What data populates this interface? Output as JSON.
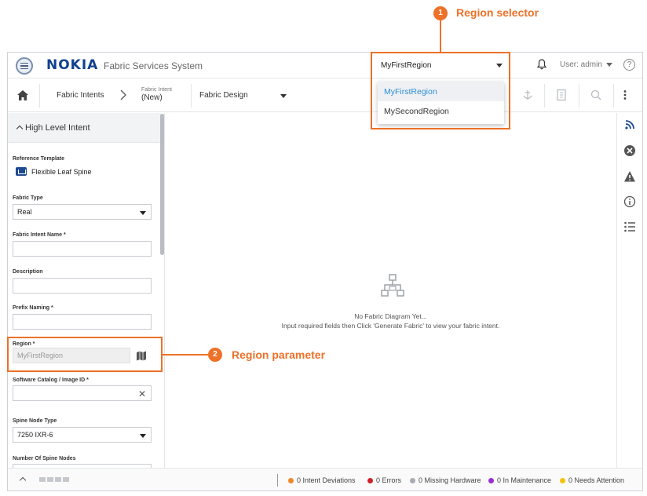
{
  "header": {
    "logo": "NOKIA",
    "app_title": "Fabric Services System",
    "region_selected": "MyFirstRegion",
    "user_label": "User: admin",
    "help": "?"
  },
  "toolbar": {
    "breadcrumb_intents": "Fabric Intents",
    "breadcrumb_intent_small": "Fabric Intent",
    "breadcrumb_intent_big": "(New)",
    "view_select": "Fabric Design"
  },
  "left_panel": {
    "section_title": "High Level Intent",
    "fields": {
      "reference_template_label": "Reference Template",
      "reference_template_value": "Flexible Leaf Spine",
      "fabric_type_label": "Fabric Type",
      "fabric_type_value": "Real",
      "fabric_intent_name_label": "Fabric Intent Name *",
      "fabric_intent_name_value": "",
      "description_label": "Description",
      "description_value": "",
      "prefix_naming_label": "Prefix Naming *",
      "prefix_naming_value": "",
      "region_label": "Region *",
      "region_value": "MyFirstRegion",
      "software_label": "Software Catalog / Image ID *",
      "software_value": "",
      "spine_type_label": "Spine Node Type",
      "spine_type_value": "7250 IXR-6",
      "spine_count_label": "Number Of Spine Nodes"
    }
  },
  "center": {
    "empty_title": "No Fabric Diagram Yet...",
    "empty_hint": "Input required fields then Click 'Generate Fabric' to view your fabric intent."
  },
  "region_dropdown": {
    "options": [
      "MyFirstRegion",
      "MySecondRegion"
    ]
  },
  "footer": {
    "stats": [
      {
        "label": "0 Intent Deviations",
        "color": "#f0882a"
      },
      {
        "label": "0 Errors",
        "color": "#d0202a"
      },
      {
        "label": "0 Missing Hardware",
        "color": "#a8adb3"
      },
      {
        "label": "0 In Maintenance",
        "color": "#9b2fd3"
      },
      {
        "label": "0 Needs Attention",
        "color": "#f4c20d"
      }
    ]
  },
  "annotations": {
    "one": {
      "number": "1",
      "text": "Region selector"
    },
    "two": {
      "number": "2",
      "text": "Region parameter"
    },
    "color": "#ed7128"
  },
  "icons": {
    "menu": "hamburger-icon",
    "bell": "bell-icon",
    "home": "home-icon",
    "breadcrumb_sep": "chevron-right-icon",
    "template": "template-icon",
    "map": "map-icon",
    "clear": "close-icon",
    "diagram": "diagram-icon",
    "rail": [
      "rss-icon",
      "error-icon",
      "warning-icon",
      "info-icon",
      "list-icon"
    ]
  }
}
